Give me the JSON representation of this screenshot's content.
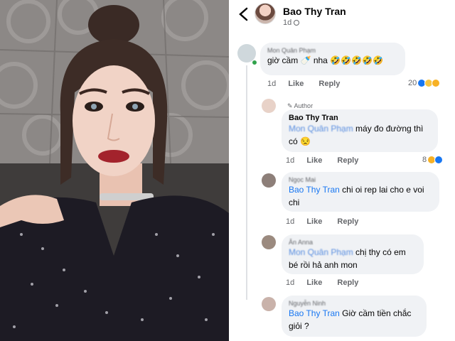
{
  "header": {
    "name": "Bao Thy Tran",
    "time": "1d"
  },
  "comments": [
    {
      "name": "Mon Quân Phạm",
      "text": "giờ cầm 🍼 nha 🤣🤣🤣🤣🤣",
      "time": "1d",
      "like": "Like",
      "reply": "Reply",
      "reactions": "20"
    },
    {
      "tag": "Author",
      "name": "Bao Thy Tran",
      "mention": "Mon Quân Phạm",
      "text": " máy đo đường thì có 😒",
      "time": "1d",
      "like": "Like",
      "reply": "Reply",
      "reactions": "8"
    },
    {
      "name": "Ngọc Mai",
      "mention": "Bao Thy Tran",
      "text": " chi oi rep lai cho e voi chi",
      "time": "1d",
      "like": "Like",
      "reply": "Reply"
    },
    {
      "name": "Ân Anna",
      "mention": "Mon Quân Phạm",
      "text": " chị thy có em bé rồi hả anh mon",
      "time": "1d",
      "like": "Like",
      "reply": "Reply"
    },
    {
      "name": "Nguyễn Ninh",
      "mention": "Bao Thy Tran",
      "text": " Giờ cầm tiền chắc giỏi ?"
    }
  ]
}
